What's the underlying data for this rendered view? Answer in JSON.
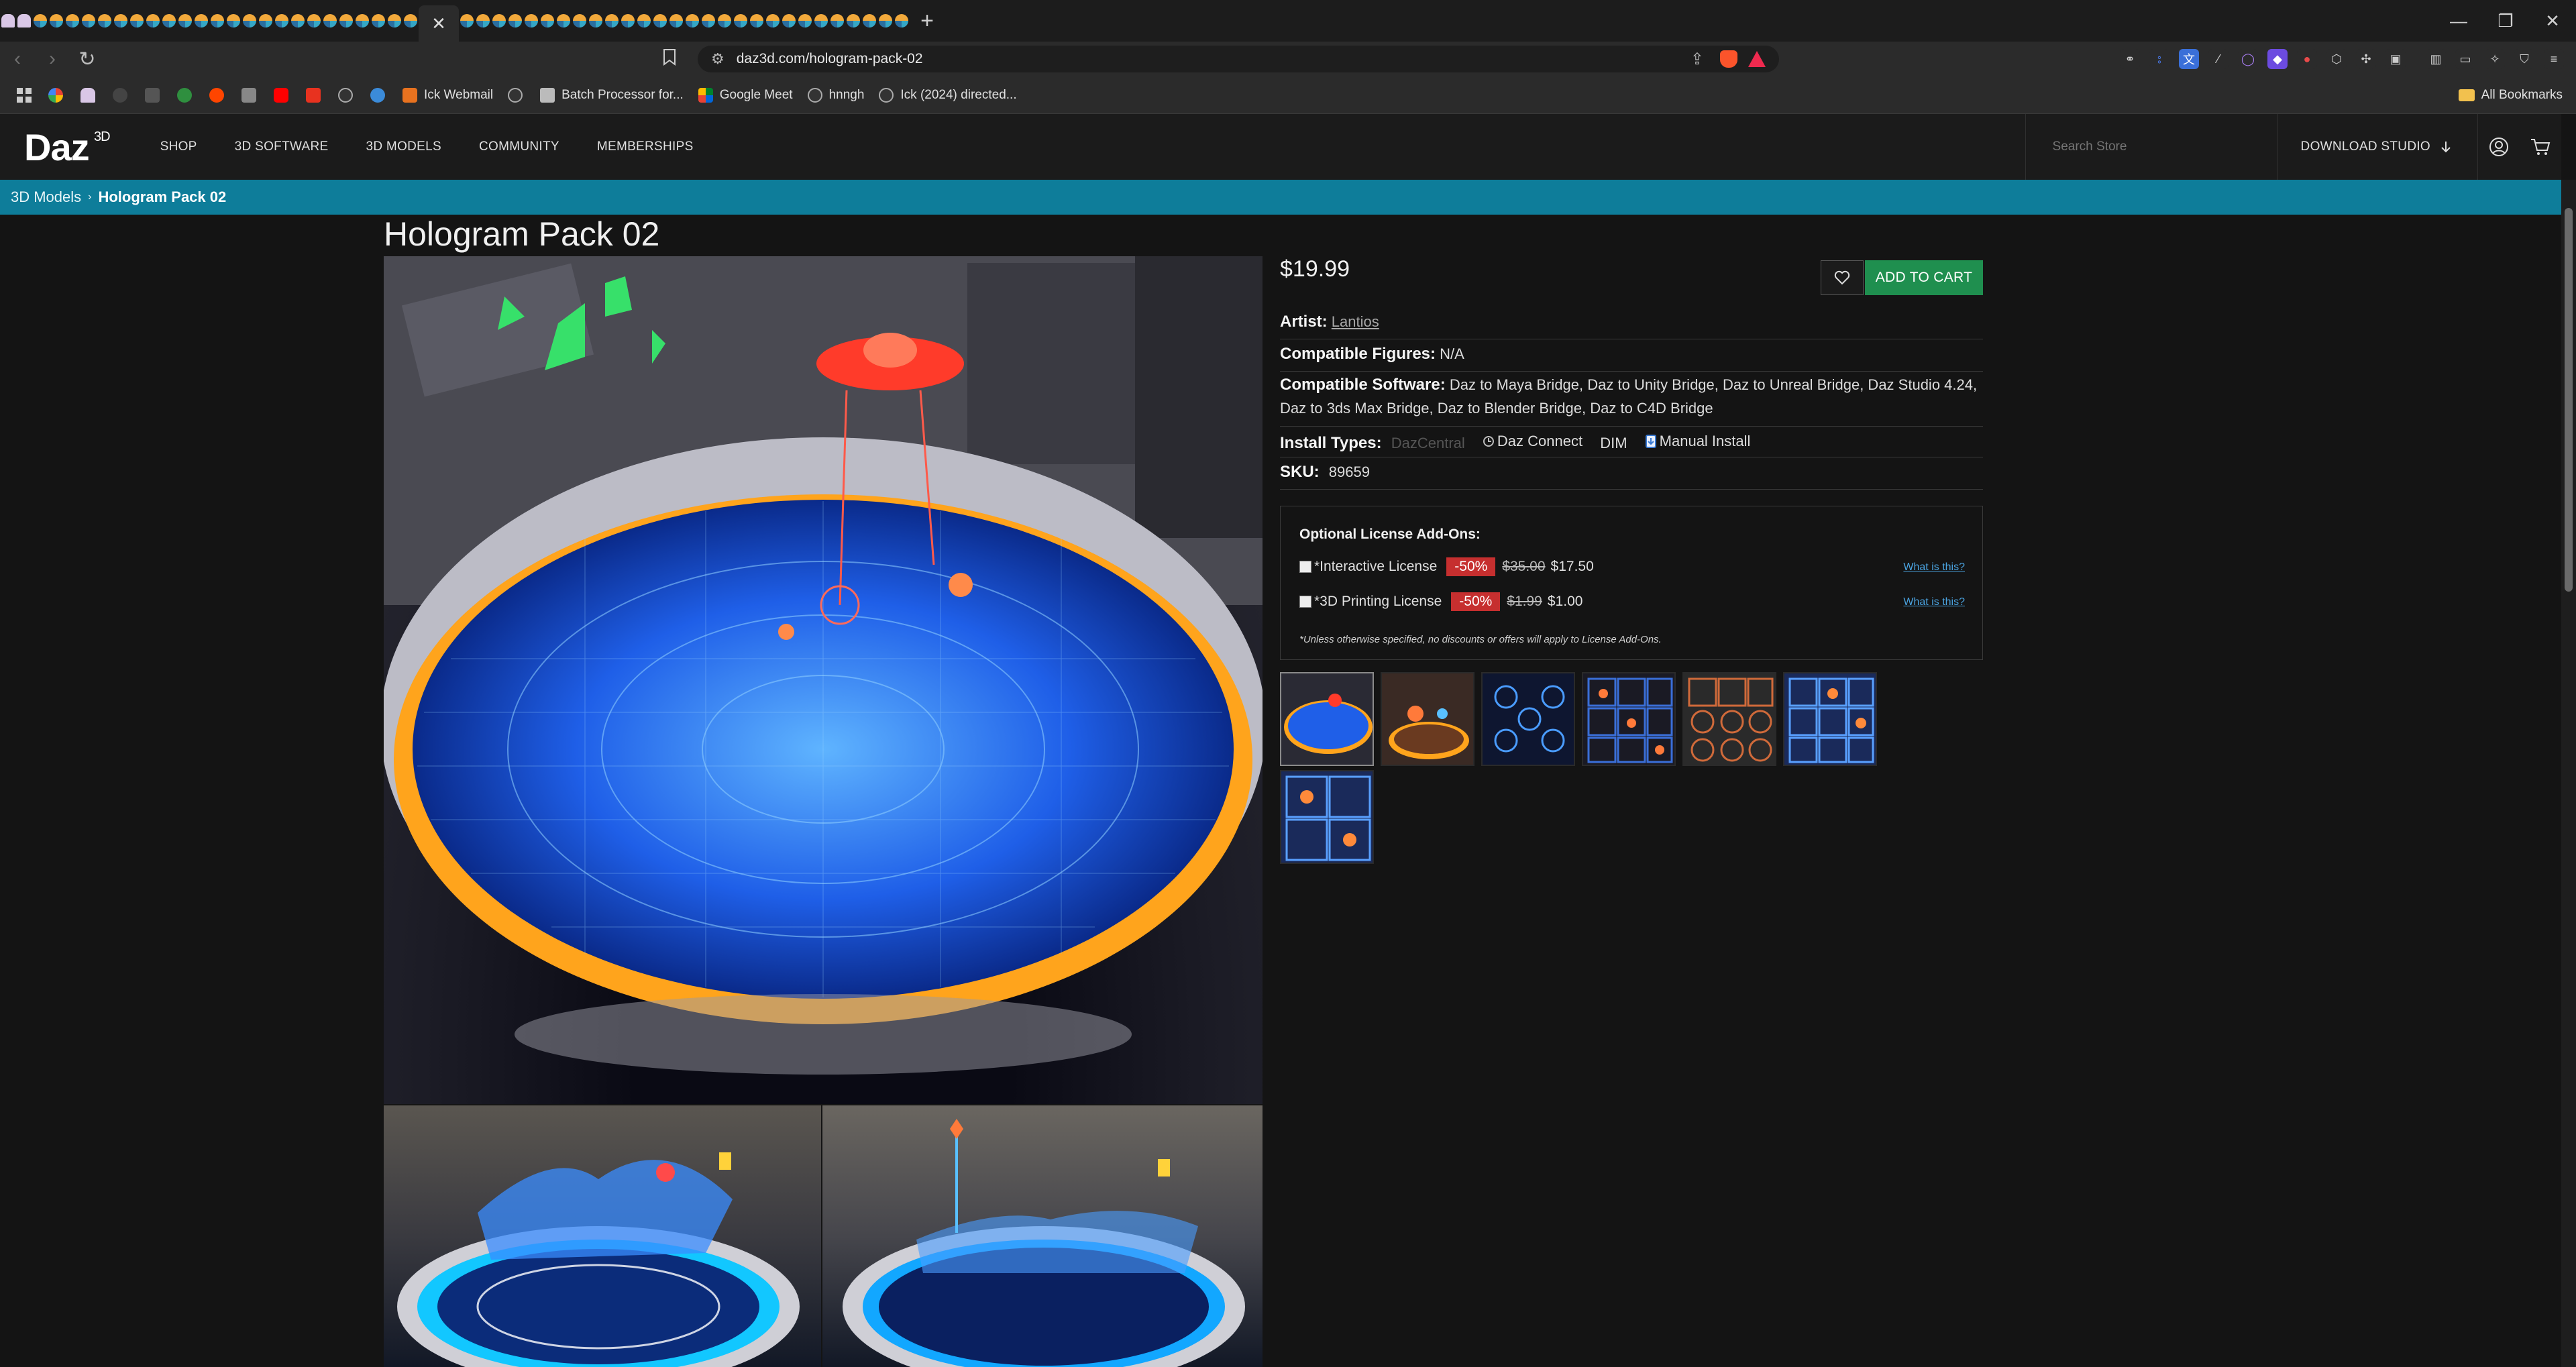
{
  "browser": {
    "tab_glyph_count": 54,
    "active_tab_close": "✕",
    "window_controls": [
      "—",
      "❐",
      "✕"
    ],
    "new_tab": "+",
    "url": "daz3d.com/hologram-pack-02",
    "bookmarks": [
      "Ick Webmail",
      "Batch Processor for...",
      "Google Meet",
      "hnngh",
      "Ick (2024) directed..."
    ],
    "all_bookmarks": "All Bookmarks"
  },
  "site": {
    "logo": "Daz",
    "logo_sup": "3D",
    "nav": [
      "SHOP",
      "3D SOFTWARE",
      "3D MODELS",
      "COMMUNITY",
      "MEMBERSHIPS"
    ],
    "search_placeholder": "Search Store",
    "download_studio": "DOWNLOAD STUDIO"
  },
  "breadcrumb": {
    "parent": "3D Models",
    "sep": "›",
    "current": "Hologram Pack 02"
  },
  "product": {
    "title": "Hologram Pack 02",
    "price": "$19.99",
    "add_to_cart": "ADD TO CART",
    "artist_label": "Artist:",
    "artist": "Lantios",
    "figures_label": "Compatible Figures:",
    "figures": "N/A",
    "software_label": "Compatible Software:",
    "software": "Daz to Maya Bridge, Daz to Unity Bridge, Daz to Unreal Bridge, Daz Studio 4.24, Daz to 3ds Max Bridge, Daz to Blender Bridge, Daz to C4D Bridge",
    "install_label": "Install Types:",
    "install_types": [
      "DazCentral",
      "Daz Connect",
      "DIM",
      "Manual Install"
    ],
    "sku_label": "SKU:",
    "sku": "89659"
  },
  "license": {
    "heading": "Optional License Add-Ons:",
    "items": [
      {
        "name": "*Interactive License",
        "discount": "-50%",
        "old_price": "$35.00",
        "price": "$17.50",
        "link": "What is this?",
        "checked": false
      },
      {
        "name": "*3D Printing License",
        "discount": "-50%",
        "old_price": "$1.99",
        "price": "$1.00",
        "link": "What is this?",
        "checked": false
      }
    ],
    "note": "*Unless otherwise specified, no discounts or offers will apply to License Add-Ons."
  },
  "colors": {
    "teal": "#0e7d9a",
    "cart_green": "#1f8f4f",
    "discount_red": "#c62f2f",
    "hologram_blue": "#2f7bff",
    "ring_orange": "#ffa41c"
  }
}
